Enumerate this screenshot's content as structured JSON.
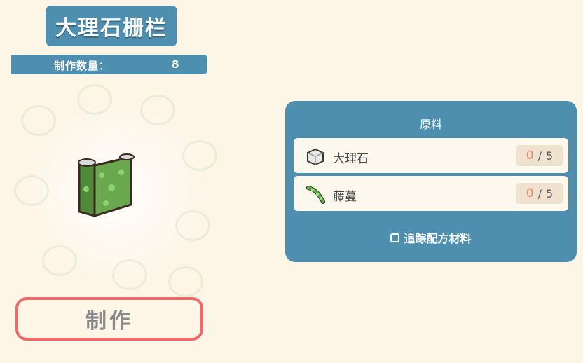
{
  "recipe": {
    "title": "大理石栅栏",
    "quantity_label": "制作数量：",
    "quantity_value": "8",
    "make_button_label": "制作"
  },
  "materials_panel": {
    "title": "原料",
    "items": [
      {
        "name": "大理石",
        "icon": "marble-icon",
        "have": "0",
        "sep": "/",
        "need": "5"
      },
      {
        "name": "藤蔓",
        "icon": "vine-icon",
        "have": "0",
        "sep": "/",
        "need": "5"
      }
    ],
    "track_label": "追踪配方材料",
    "track_checked": false
  },
  "colors": {
    "accent_blue": "#4e8faf",
    "background": "#fdf5e6",
    "button_border": "#ef6a6a",
    "have_count": "#ef7b6b"
  }
}
